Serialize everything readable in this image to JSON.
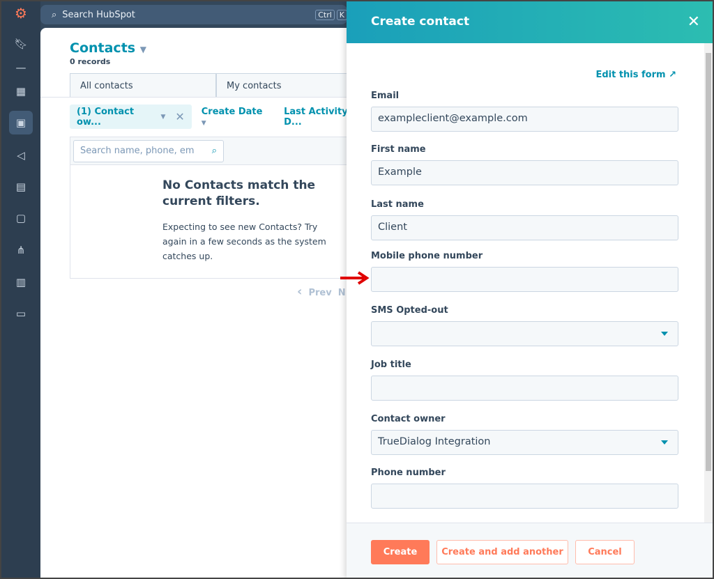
{
  "nav": {
    "search_placeholder": "Search HubSpot",
    "kbd_ctrl": "Ctrl",
    "kbd_k": "K"
  },
  "main": {
    "title": "Contacts",
    "records": "0 records",
    "tabs": [
      "All contacts",
      "My contacts"
    ],
    "filters": {
      "chip": "(1) Contact ow...",
      "create_date": "Create Date",
      "last_activity": "Last Activity D..."
    },
    "search_placeholder": "Search name, phone, em",
    "empty_title": "No Contacts match the current filters.",
    "empty_text": "Expecting to see new Contacts? Try again in a few seconds as the system catches up.",
    "pager_prev": "Prev",
    "pager_next": "N"
  },
  "panel": {
    "title": "Create contact",
    "edit_form": "Edit this form",
    "fields": [
      {
        "label": "Email",
        "value": "exampleclient@example.com"
      },
      {
        "label": "First name",
        "value": "Example"
      },
      {
        "label": "Last name",
        "value": "Client"
      },
      {
        "label": "Mobile phone number",
        "value": ""
      },
      {
        "label": "SMS Opted-out",
        "value": ""
      },
      {
        "label": "Job title",
        "value": ""
      },
      {
        "label": "Contact owner",
        "value": "TrueDialog Integration"
      },
      {
        "label": "Phone number",
        "value": ""
      }
    ],
    "buttons": {
      "create": "Create",
      "create_another": "Create and add another",
      "cancel": "Cancel"
    }
  },
  "colors": {
    "accent": "#0091ae",
    "primary_button": "#ff7a59",
    "annotation_arrow": "#e00000"
  }
}
